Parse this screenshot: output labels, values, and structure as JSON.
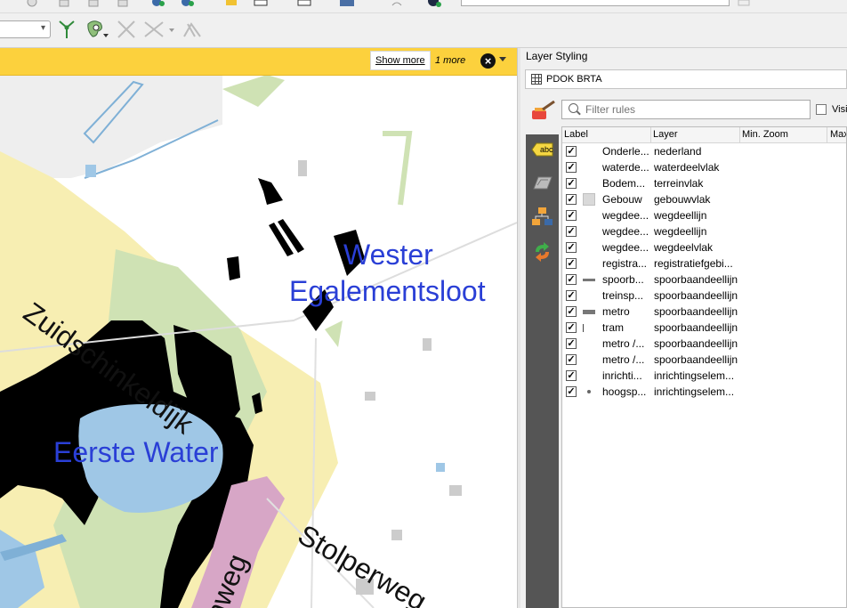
{
  "message_bar": {
    "show_more_label": "Show more",
    "more_count_label": "1 more",
    "close_glyph": "×"
  },
  "map": {
    "labels": {
      "zuidschinkeldijk": "Zuidschinkeldijk",
      "wester": "Wester",
      "egalementsloot": "Egalementsloot",
      "eerste_water": "Eerste Water",
      "stolperweg": "Stolperweg",
      "road_bottom": "nweg"
    },
    "colors": {
      "land_yellow": "#f7eeb2",
      "water": "#9fc7e6",
      "green": "#cfe2b4",
      "black": "#000000",
      "pink": "#d7a6c6",
      "label_blue": "#2a3fd6"
    }
  },
  "panel": {
    "title": "Layer Styling",
    "layer_name": "PDOK BRTA",
    "filter_placeholder": "Filter rules",
    "visible_label": "Visi",
    "columns": {
      "label": "Label",
      "layer": "Layer",
      "min_zoom": "Min. Zoom",
      "max_zoom": "Max"
    },
    "rules": [
      {
        "label": "Onderle...",
        "layer": "nederland",
        "checked": true,
        "symbol": "none"
      },
      {
        "label": "waterde...",
        "layer": "waterdeelvlak",
        "checked": true,
        "symbol": "none"
      },
      {
        "label": "Bodem...",
        "layer": "terreinvlak",
        "checked": true,
        "symbol": "none"
      },
      {
        "label": "Gebouw",
        "layer": "gebouwvlak",
        "checked": true,
        "symbol": "fill"
      },
      {
        "label": "wegdee...",
        "layer": "wegdeellijn",
        "checked": true,
        "symbol": "none"
      },
      {
        "label": "wegdee...",
        "layer": "wegdeellijn",
        "checked": true,
        "symbol": "none"
      },
      {
        "label": "wegdee...",
        "layer": "wegdeelvlak",
        "checked": true,
        "symbol": "none"
      },
      {
        "label": "registra...",
        "layer": "registratiefgebi...",
        "checked": true,
        "symbol": "none"
      },
      {
        "label": "spoorb...",
        "layer": "spoorbaandeellijn",
        "checked": true,
        "symbol": "line"
      },
      {
        "label": "treinsp...",
        "layer": "spoorbaandeellijn",
        "checked": true,
        "symbol": "none"
      },
      {
        "label": "metro",
        "layer": "spoorbaandeellijn",
        "checked": true,
        "symbol": "thickline"
      },
      {
        "label": "tram",
        "layer": "spoorbaandeellijn",
        "checked": true,
        "symbol": "tick"
      },
      {
        "label": "metro /...",
        "layer": "spoorbaandeellijn",
        "checked": true,
        "symbol": "none"
      },
      {
        "label": "metro /...",
        "layer": "spoorbaandeellijn",
        "checked": true,
        "symbol": "none"
      },
      {
        "label": "inrichti...",
        "layer": "inrichtingselem...",
        "checked": true,
        "symbol": "none"
      },
      {
        "label": "hoogsp...",
        "layer": "inrichtingselem...",
        "checked": true,
        "symbol": "dot"
      }
    ],
    "sidebar_icons": [
      "label-abc-icon",
      "masking-icon",
      "rule-tree-icon",
      "history-icon"
    ]
  }
}
